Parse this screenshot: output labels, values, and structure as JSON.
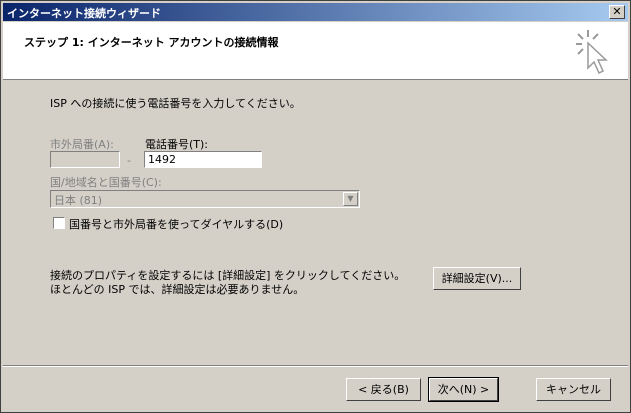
{
  "window": {
    "title": "インターネット接続ウィザード",
    "close_label": "✕"
  },
  "header": {
    "step": "ステップ 1: インターネット アカウントの接続情報"
  },
  "body": {
    "intro": "ISP への接続に使う電話番号を入力してください。",
    "area_code": {
      "label": "市外局番(A):",
      "value": ""
    },
    "dash": "-",
    "phone": {
      "label": "電話番号(T):",
      "value": "1492"
    },
    "country": {
      "label": "国/地域名と国番号(C):",
      "value": "日本 (81)"
    },
    "use_area_code": {
      "label": "国番号と市外局番を使ってダイヤルする(D)",
      "checked": false
    },
    "properties_text_1": "接続のプロパティを設定するには [詳細設定] をクリックしてください。",
    "properties_text_2": "ほとんどの ISP では、詳細設定は必要ありません。",
    "advanced_button": "詳細設定(V)..."
  },
  "footer": {
    "back_button": "< 戻る(B)",
    "next_button": "次へ(N) >",
    "cancel_button": "キャンセル"
  }
}
